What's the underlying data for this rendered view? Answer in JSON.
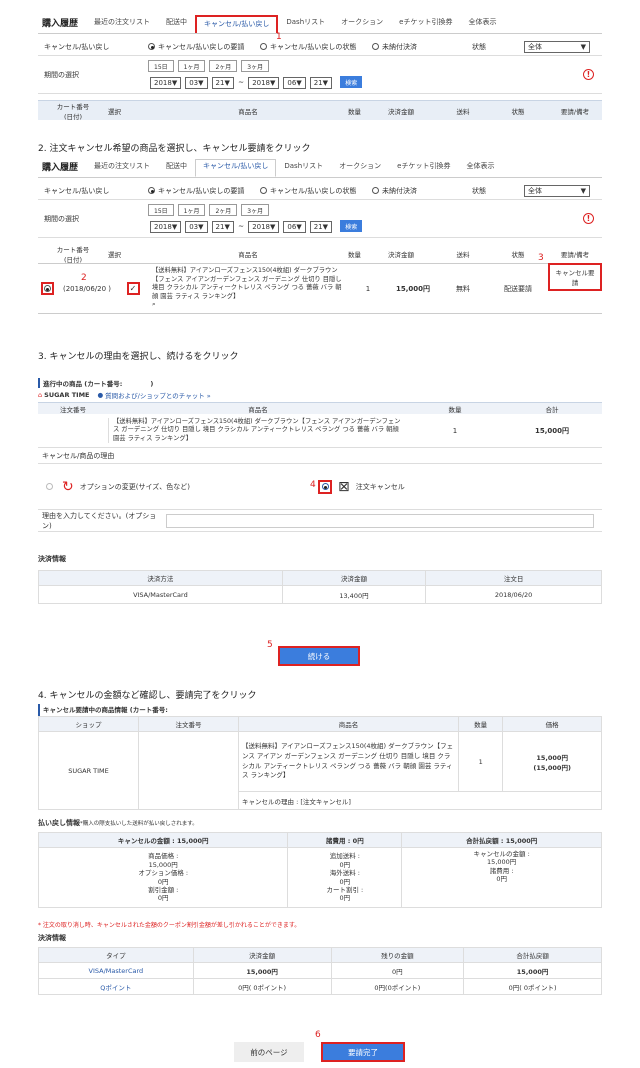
{
  "s1": {
    "title": "購入履歴",
    "tabs": [
      "最近の注文リスト",
      "配送中",
      "キャンセル/払い戻し",
      "Dashリスト",
      "オークション",
      "eチケット引換券",
      "全体表示"
    ],
    "filter_label": "キャンセル/払い戻し",
    "radio1": "キャンセル/払い戻しの要請",
    "radio2": "キャンセル/払い戻しの状態",
    "radio3": "未納付決済",
    "status_label": "状態",
    "status_value": "全体",
    "period_label": "期間の選択",
    "period_btns": [
      "15日",
      "1ヶ月",
      "2ヶ月",
      "3ヶ月"
    ],
    "y1": "2018",
    "m1": "03",
    "d1": "21",
    "sep": "~",
    "y2": "2018",
    "m2": "06",
    "d2": "21",
    "search": "検索",
    "cols": [
      "カート番号\n(日付)",
      "選択",
      "商品名",
      "数量",
      "決済金額",
      "送料",
      "状態",
      "要請/備考"
    ],
    "n1": "1"
  },
  "step2": "2. 注文キャンセル希望の商品を選択し、キャンセル要請をクリック",
  "s2": {
    "date": "(2018/06/20 )",
    "n2": "2",
    "n3": "3",
    "product": "【送料無料】アイアンローズフェンス150(4枚組) ダークブラウン【フェンス アイアンガーデンフェンス ガーデニング 仕切り 目隠し 境目 クラシカル アンティークトレリス ペラング つる 薔薇 バラ 朝顔 園芸 ラティス ランキング】",
    "qty": "1",
    "amount": "15,000円",
    "ship": "無料",
    "status": "配送要請",
    "cancel_btn": "キャンセル要請"
  },
  "step3": "3. キャンセルの理由を選択し、続けるをクリック",
  "s3": {
    "progress": "進行中の商品 (カート番号:",
    "progress_end": ")",
    "shop": "SUGAR TIME",
    "chat": "質問および/ショップとのチャット »",
    "cols": [
      "注文番号",
      "商品名",
      "数量",
      "合計"
    ],
    "product": "【送料無料】アイアンローズフェンス150(4枚組) ダークブラウン【フェンス アイアンガーデンフェンス ガーデニング 仕切り 目隠し 境目 クラシカル アンティークトレリス ペラング つる 薔薇 バラ 朝顔 園芸 ラティス ランキング】",
    "qty": "1",
    "total": "15,000円",
    "reason_label": "キャンセル/商品の理由",
    "opt1": "オプションの変更(サイズ、色など)",
    "n4": "4",
    "opt2": "注文キャンセル",
    "reason_input": "理由を入力してください。(オプション)",
    "pay_title": "決済情報",
    "pay_cols": [
      "決済方法",
      "決済金額",
      "注文日"
    ],
    "pay_vals": [
      "VISA/MasterCard",
      "13,400円",
      "2018/06/20"
    ],
    "n5": "5",
    "continue": "続ける"
  },
  "step4": "4. キャンセルの金額など確認し、要請完了をクリック",
  "s4": {
    "title": "キャンセル要請中の商品情報 (カート番号:",
    "cols": [
      "ショップ",
      "注文番号",
      "商品名",
      "数量",
      "価格"
    ],
    "shop": "SUGAR TIME",
    "product": "【送料無料】アイアンローズフェンス150(4枚組) ダークブラウン【フェンス アイアン ガーデンフェンス ガーデニング 仕切り 目隠し 境目 クラシカル アンティークトレリス ペラング つる 薔薇 バラ 朝顔 園芸 ラティス ランキング】",
    "qty": "1",
    "price": "15,000円",
    "price2": "(15,000円)",
    "reason": "キャンセルの理由 : [注文キャンセル]",
    "refund_title": "払い戻し情報",
    "refund_note": "*購入の際支払いした送料が払い戻しされます。",
    "r_cols": [
      "キャンセルの金額 : 15,000円",
      "諸費用 : 0円",
      "合計払戻額 : 15,000円"
    ],
    "r_c1": [
      "商品価格 :",
      "15,000円",
      "オプション価格 :",
      "0円",
      "割引金額 :",
      "0円"
    ],
    "r_c2": [
      "追加送料 :",
      "0円",
      "海外送料 :",
      "0円",
      "カート割引 :",
      "0円"
    ],
    "r_c3": [
      "キャンセルの金額 :",
      "15,000円",
      "諸費用 :",
      "0円"
    ],
    "warning": "* 注文の取り消し時、キャンセルされた金額のクーポン割引金額が差し引かれることができます。",
    "pay_title": "決済情報",
    "p_cols": [
      "タイプ",
      "決済金額",
      "残りの金額",
      "合計払戻額"
    ],
    "p_r1": [
      "VISA/MasterCard",
      "15,000円",
      "0円",
      "15,000円"
    ],
    "p_r2": [
      "Qポイント",
      "0円( 0ポイント)",
      "0円(0ポイント)",
      "0円( 0ポイント)"
    ],
    "prev": "前のページ",
    "n6": "6",
    "complete": "要請完了"
  }
}
